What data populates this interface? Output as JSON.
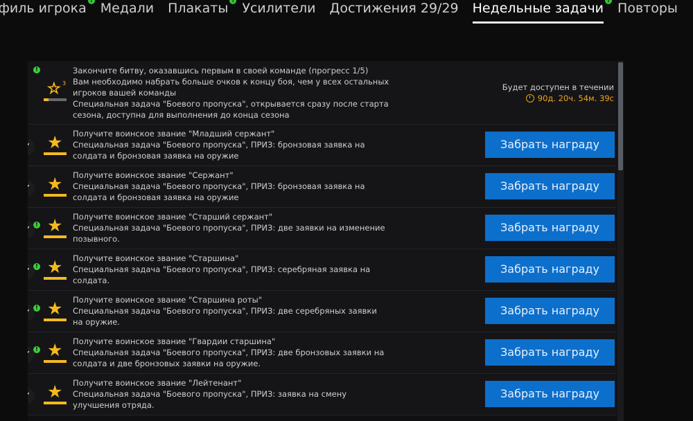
{
  "tabs": [
    {
      "label": "офиль игрока",
      "badge": "!"
    },
    {
      "label": "Медали",
      "badge": ""
    },
    {
      "label": "Плакаты",
      "badge": "!"
    },
    {
      "label": "Усилители",
      "badge": ""
    },
    {
      "label": "Достижения 29/29",
      "badge": ""
    },
    {
      "label": "Недельные задачи",
      "badge": "!",
      "active": true
    },
    {
      "label": "Повторы",
      "badge": ""
    }
  ],
  "first_task": {
    "level": "3",
    "progress": 0.2,
    "lines": [
      "Закончите битву, оказавшись первым в своей команде (прогресс 1/5)",
      "Вам необходимо набрать больше очков к концу боя, чем у всех остальных",
      "игроков вашей команды",
      "Специальная задача \"Боевого пропуска\", открывается сразу после старта",
      "сезона, доступна для выполнения до конца сезона"
    ],
    "availability_label": "Будет доступен в течении",
    "availability_time": "90д. 20ч. 54м. 39с"
  },
  "claim_label": "Забрать награду",
  "tasks": [
    {
      "alert": false,
      "lines": [
        "Получите воинское звание \"Младший сержант\"",
        "Специальная задача \"Боевого пропуска\", ПРИЗ: бронзовая заявка на",
        "солдата и бронзовая заявка на оружие"
      ]
    },
    {
      "alert": false,
      "lines": [
        "Получите воинское звание \"Сержант\"",
        "Специальная задача \"Боевого пропуска\", ПРИЗ: бронзовая заявка на",
        "солдата и бронзовая заявка на оружие"
      ]
    },
    {
      "alert": true,
      "lines": [
        "Получите воинское звание \"Старший сержант\"",
        "Специальная задача \"Боевого пропуска\", ПРИЗ: две заявки на изменение",
        "позывного."
      ]
    },
    {
      "alert": true,
      "lines": [
        "Получите воинское звание \"Старшина\"",
        "Специальная задача \"Боевого пропуска\", ПРИЗ: серебряная заявка на",
        "солдата."
      ]
    },
    {
      "alert": true,
      "lines": [
        "Получите воинское звание \"Старшина роты\"",
        "Специальная задача \"Боевого пропуска\", ПРИЗ: две серебряных заявки",
        "на оружие."
      ]
    },
    {
      "alert": true,
      "lines": [
        "Получите воинское звание \"Гвардии старшина\"",
        "Специальная задача \"Боевого пропуска\", ПРИЗ: две бронзовых заявки на",
        "солдата и две бронзовых заявки на оружие."
      ]
    },
    {
      "alert": false,
      "lines": [
        "Получите воинское звание \"Лейтенант\"",
        "Специальная задача \"Боевого пропуска\", ПРИЗ: заявка на смену",
        "улучшения отряда."
      ]
    }
  ]
}
